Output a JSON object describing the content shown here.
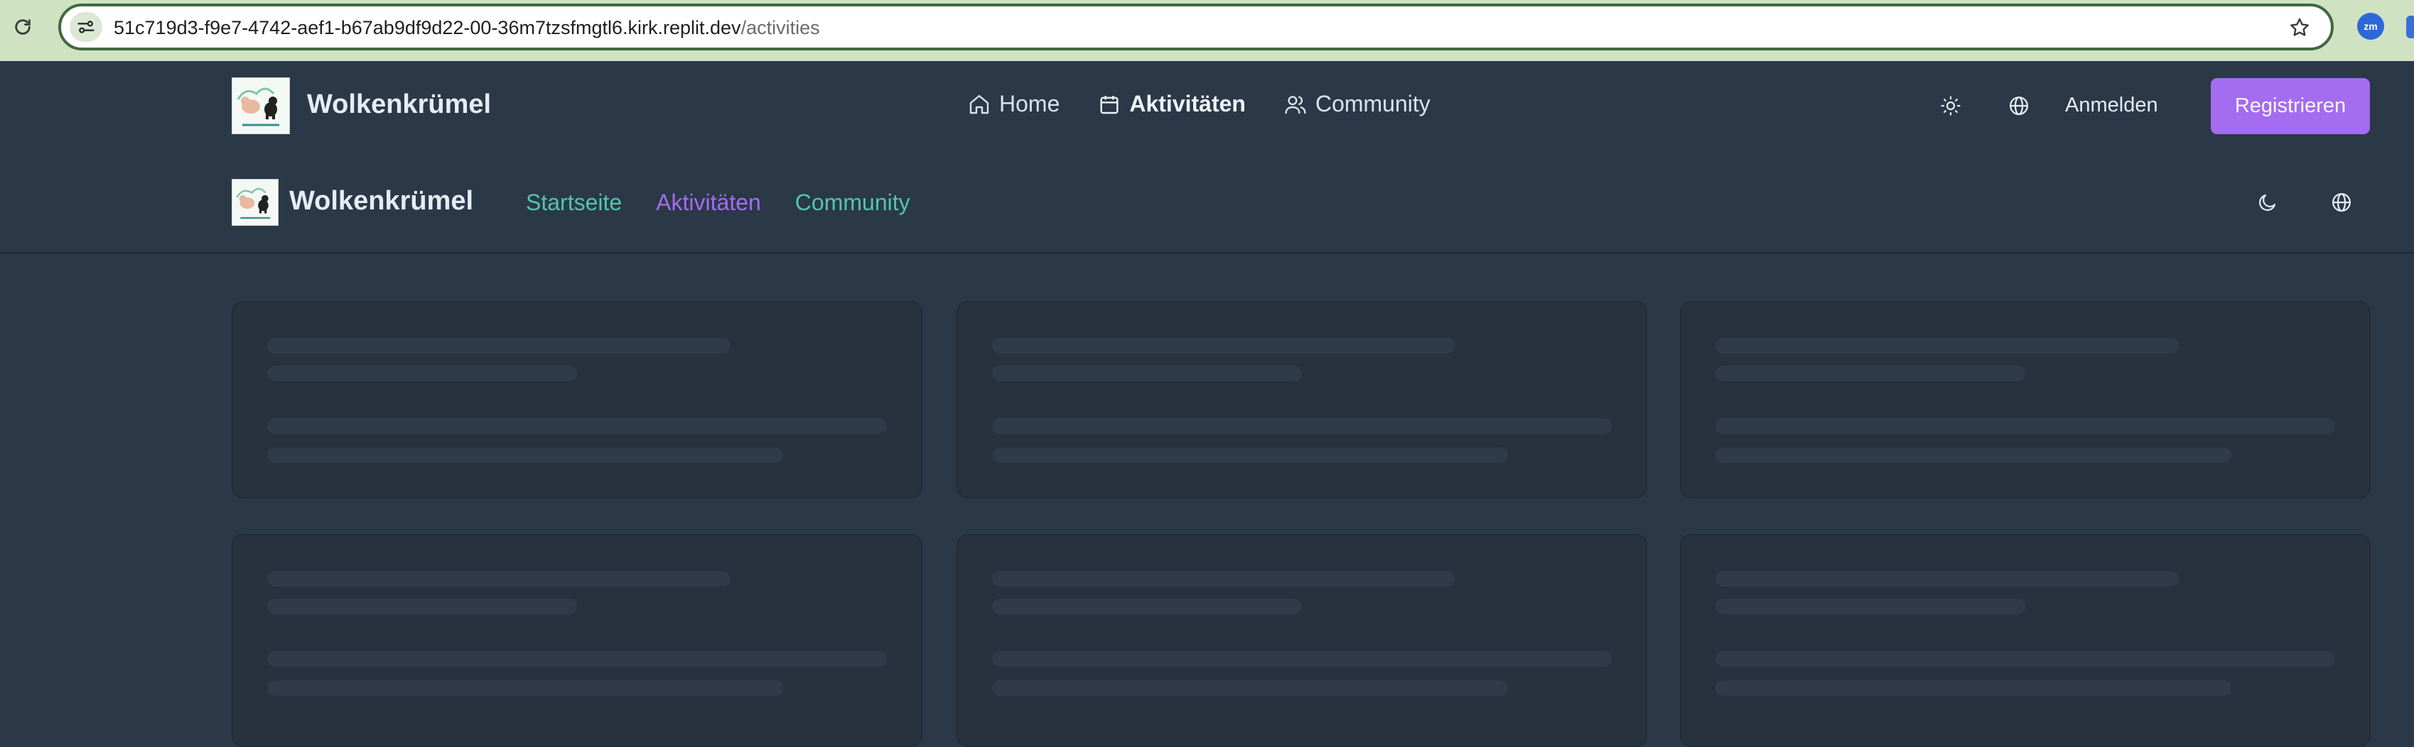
{
  "browser": {
    "url_host": "51c719d3-f9e7-4742-aef1-b67ab9df9d22-00-36m7tzsfmgtl6.kirk.replit.dev",
    "url_path": "/activities",
    "extension_label": "zm",
    "icons": [
      "reload-icon",
      "site-info-icon",
      "bookmark-star-icon",
      "zoom-extension-icon"
    ]
  },
  "header1": {
    "brand": "Wolkenkrümel",
    "nav": [
      {
        "label": "Home",
        "icon": "home-icon",
        "active": false
      },
      {
        "label": "Aktivitäten",
        "icon": "calendar-icon",
        "active": true
      },
      {
        "label": "Community",
        "icon": "users-icon",
        "active": false
      }
    ],
    "theme_icon": "sun-icon",
    "language_icon": "globe-icon",
    "login_label": "Anmelden",
    "register_label": "Registrieren"
  },
  "header2": {
    "brand": "Wolkenkrümel",
    "nav": [
      {
        "label": "Startseite",
        "active": false
      },
      {
        "label": "Aktivitäten",
        "active": true
      },
      {
        "label": "Community",
        "active": false
      }
    ],
    "theme_icon": "moon-icon",
    "language_icon": "globe-icon"
  },
  "content": {
    "state": "loading",
    "skeleton_cards": 6
  },
  "colors": {
    "background": "#2b3848",
    "accent_purple": "#a46cf0",
    "link_teal": "#52c6a6",
    "skeleton": "#303b49"
  }
}
